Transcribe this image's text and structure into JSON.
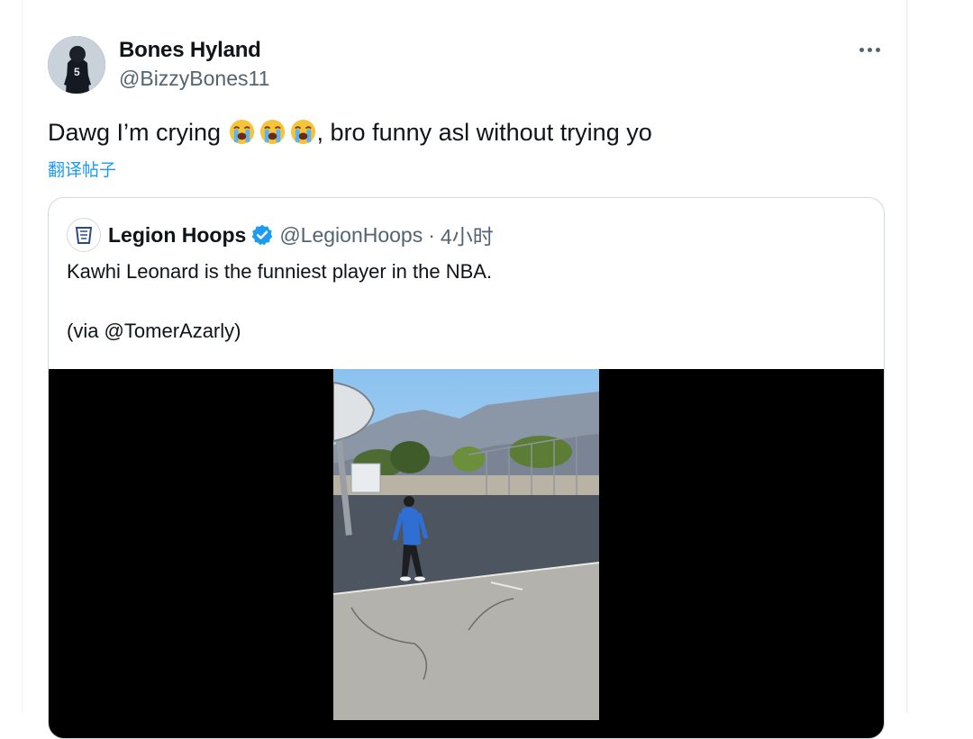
{
  "tweet": {
    "author_name": "Bones Hyland",
    "author_handle": "@BizzyBones11",
    "text_before_emoji": "Dawg I’m crying ",
    "emojis": [
      "😭",
      "😭",
      "😭"
    ],
    "text_after_emoji": ", bro funny asl without trying yo",
    "translate_label": "翻译帖子",
    "more_icon": "more-horizontal-icon"
  },
  "quote": {
    "author_name": "Legion Hoops",
    "verified": true,
    "author_handle": "@LegionHoops",
    "separator": "·",
    "time": "4小时",
    "text": "Kawhi Leonard is the funniest player in the NBA.",
    "via": "(via @TomerAzarly)",
    "media_type": "video"
  },
  "colors": {
    "link": "#1d9bf0",
    "secondary_text": "#536471",
    "border": "#cfd9de",
    "verified_badge": "#1d9bf0"
  }
}
